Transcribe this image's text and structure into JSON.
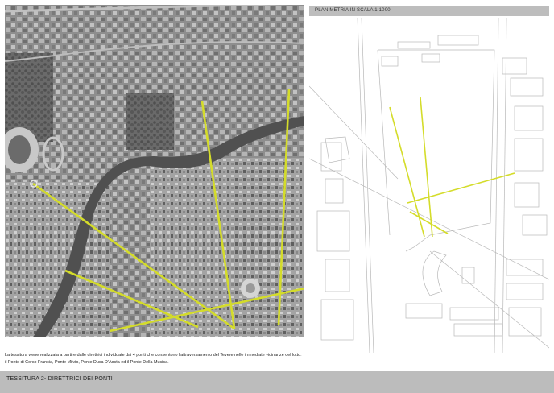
{
  "plan_header": {
    "label": "PLANIMETRIA IN SCALA 1:1000"
  },
  "caption": {
    "text": "La tessitura viene realizzata a partire dalle direttrici individuate dai 4 ponti che consentono l'attraversamento del Tevere nelle immediate vicinanze del lotto: il Ponte di Corso Francia, Ponte Milvio, Ponte Duca D'Aosta ed il Ponte Della Musica."
  },
  "footer": {
    "label": "TESSITURA 2- DIRETTRICI DEI PONTI"
  },
  "colors": {
    "accent_lines": "#d4dc2a",
    "aerial_base": "#9a9a9a",
    "river": "#505050",
    "header_bar": "#bdbdbd",
    "footer_bar": "#bcbcbc"
  },
  "images": {
    "aerial_photo": "aerial-photo-of-rome-tiber-area",
    "site_plan": "site-plan-line-drawing"
  }
}
